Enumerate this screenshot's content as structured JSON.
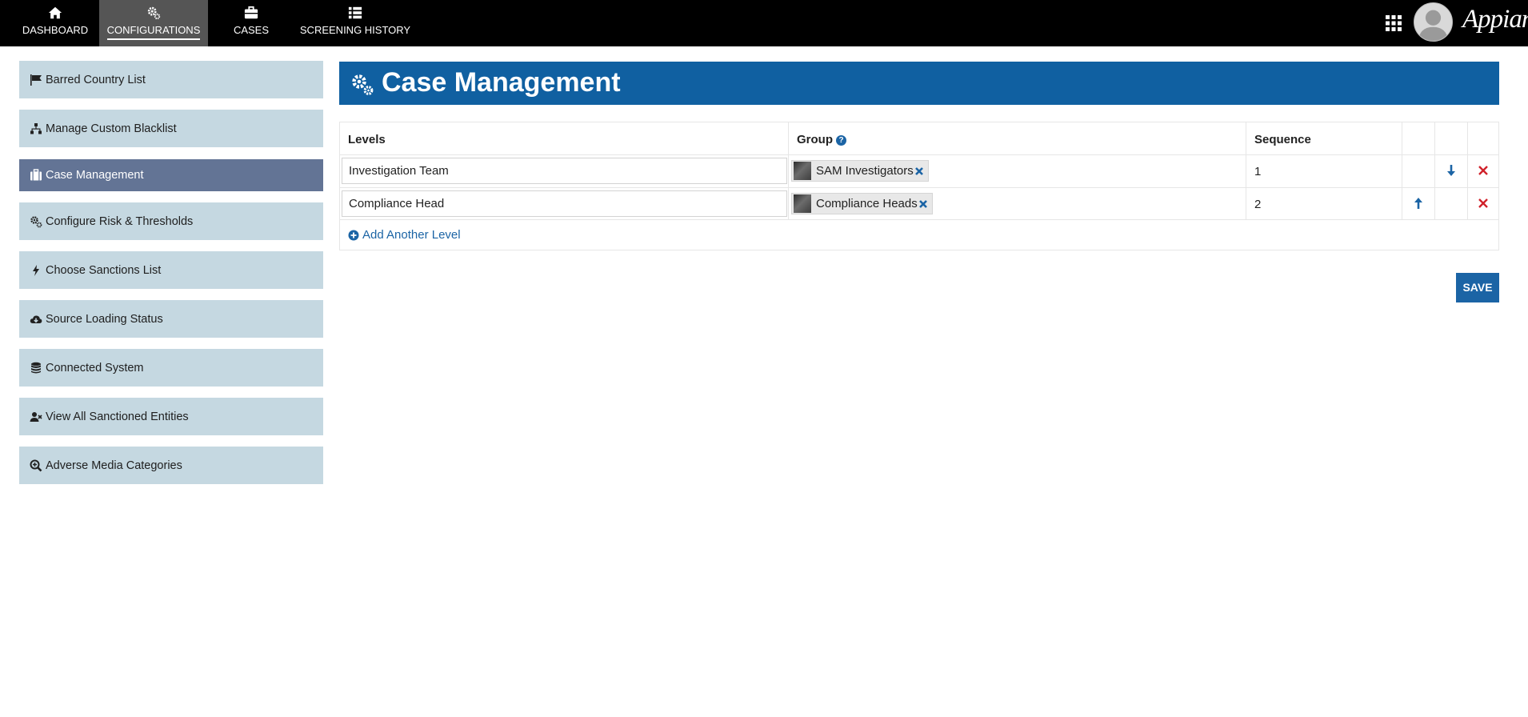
{
  "brand": "Appian",
  "nav": {
    "items": [
      {
        "label": "DASHBOARD",
        "icon": "home-icon"
      },
      {
        "label": "CONFIGURATIONS",
        "icon": "gears-icon",
        "active": true
      },
      {
        "label": "CASES",
        "icon": "briefcase-icon"
      },
      {
        "label": "SCREENING HISTORY",
        "icon": "list-icon"
      }
    ]
  },
  "sidebar": {
    "items": [
      {
        "label": "Barred Country List",
        "icon": "flag-icon"
      },
      {
        "label": "Manage Custom Blacklist",
        "icon": "sitemap-icon"
      },
      {
        "label": "Case Management",
        "icon": "suitcase-icon",
        "active": true
      },
      {
        "label": "Configure Risk & Thresholds",
        "icon": "gears-icon"
      },
      {
        "label": "Choose Sanctions List",
        "icon": "bolt-icon"
      },
      {
        "label": "Source Loading Status",
        "icon": "cloud-download-icon"
      },
      {
        "label": "Connected System",
        "icon": "database-icon"
      },
      {
        "label": "View All Sanctioned Entities",
        "icon": "user-times-icon"
      },
      {
        "label": "Adverse Media Categories",
        "icon": "search-plus-icon"
      }
    ]
  },
  "main": {
    "title": "Case Management",
    "table": {
      "headers": {
        "levels": "Levels",
        "group": "Group",
        "sequence": "Sequence"
      },
      "rows": [
        {
          "level": "Investigation Team",
          "group": "SAM Investigators",
          "sequence": "1"
        },
        {
          "level": "Compliance Head",
          "group": "Compliance Heads",
          "sequence": "2"
        }
      ]
    },
    "add_level": "Add Another Level",
    "save": "SAVE"
  },
  "colors": {
    "topbar": "#000000",
    "banner": "#1060a1",
    "sidebar": "#c5d8e1",
    "sidebar_active": "#637495",
    "link": "#1b64a5",
    "delete": "#d0212a"
  }
}
